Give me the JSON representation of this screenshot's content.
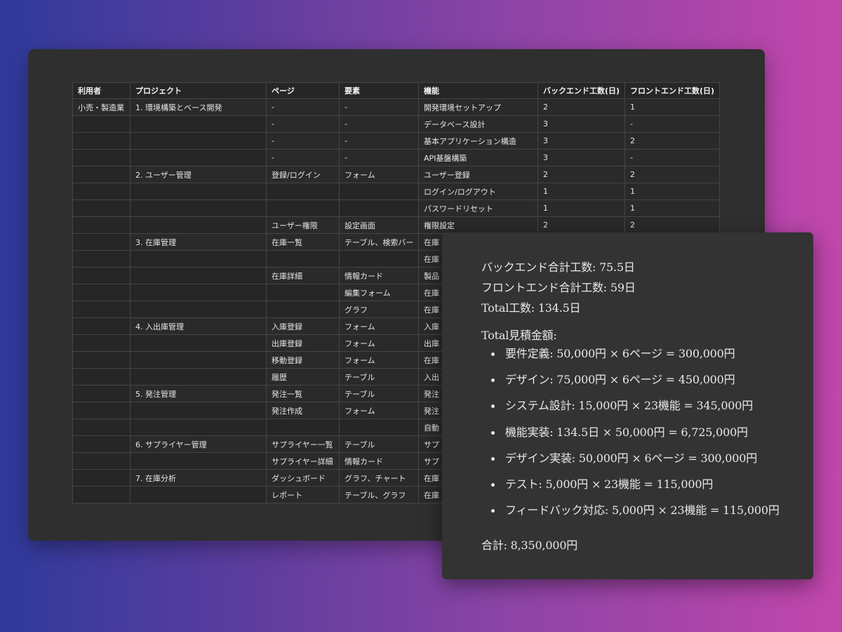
{
  "table": {
    "headers": [
      "利用者",
      "プロジェクト",
      "ページ",
      "要素",
      "機能",
      "バックエンド工数(日)",
      "フロントエンド工数(日)"
    ],
    "rows": [
      [
        "小売・製造業",
        "1. 環境構築とベース開発",
        "-",
        "-",
        "開発環境セットアップ",
        "2",
        "1"
      ],
      [
        "",
        "",
        "-",
        "-",
        "データベース設計",
        "3",
        "-"
      ],
      [
        "",
        "",
        "-",
        "-",
        "基本アプリケーション構造",
        "3",
        "2"
      ],
      [
        "",
        "",
        "-",
        "-",
        "API基盤構築",
        "3",
        "-"
      ],
      [
        "",
        "2. ユーザー管理",
        "登録/ログイン",
        "フォーム",
        "ユーザー登録",
        "2",
        "2"
      ],
      [
        "",
        "",
        "",
        "",
        "ログイン/ログアウト",
        "1",
        "1"
      ],
      [
        "",
        "",
        "",
        "",
        "パスワードリセット",
        "1",
        "1"
      ],
      [
        "",
        "",
        "ユーザー権限",
        "設定画面",
        "権限設定",
        "2",
        "2"
      ],
      [
        "",
        "3. 在庫管理",
        "在庫一覧",
        "テーブル、検索バー",
        "在庫",
        "",
        ""
      ],
      [
        "",
        "",
        "",
        "",
        "在庫",
        "",
        ""
      ],
      [
        "",
        "",
        "在庫詳細",
        "情報カード",
        "製品",
        "",
        ""
      ],
      [
        "",
        "",
        "",
        "編集フォーム",
        "在庫",
        "",
        ""
      ],
      [
        "",
        "",
        "",
        "グラフ",
        "在庫",
        "",
        ""
      ],
      [
        "",
        "4. 入出庫管理",
        "入庫登録",
        "フォーム",
        "入庫",
        "",
        ""
      ],
      [
        "",
        "",
        "出庫登録",
        "フォーム",
        "出庫",
        "",
        ""
      ],
      [
        "",
        "",
        "移動登録",
        "フォーム",
        "在庫",
        "",
        ""
      ],
      [
        "",
        "",
        "履歴",
        "テーブル",
        "入出",
        "",
        ""
      ],
      [
        "",
        "5. 発注管理",
        "発注一覧",
        "テーブル",
        "発注",
        "",
        ""
      ],
      [
        "",
        "",
        "発注作成",
        "フォーム",
        "発注",
        "",
        ""
      ],
      [
        "",
        "",
        "",
        "",
        "自動",
        "",
        ""
      ],
      [
        "",
        "6. サプライヤー管理",
        "サプライヤー一覧",
        "テーブル",
        "サプ",
        "",
        ""
      ],
      [
        "",
        "",
        "サプライヤー詳細",
        "情報カード",
        "サプ",
        "",
        ""
      ],
      [
        "",
        "7. 在庫分析",
        "ダッシュボード",
        "グラフ、チャート",
        "在庫",
        "",
        ""
      ],
      [
        "",
        "",
        "レポート",
        "テーブル、グラフ",
        "在庫",
        "",
        ""
      ]
    ]
  },
  "summary": {
    "backend_total": "バックエンド合計工数: 75.5日",
    "frontend_total": "フロントエンド合計工数: 59日",
    "total_days": "Total工数: 134.5日",
    "estimate_heading": "Total見積金額:",
    "items": [
      "要件定義: 50,000円 × 6ページ = 300,000円",
      "デザイン: 75,000円 × 6ページ = 450,000円",
      "システム設計: 15,000円 × 23機能 = 345,000円",
      "機能実装: 134.5日 × 50,000円 = 6,725,000円",
      "デザイン実装: 50,000円 × 6ページ = 300,000円",
      "テスト: 5,000円 × 23機能 = 115,000円",
      "フィードバック対応: 5,000円 × 23機能 = 115,000円"
    ],
    "grand_total": "合計: 8,350,000円"
  }
}
